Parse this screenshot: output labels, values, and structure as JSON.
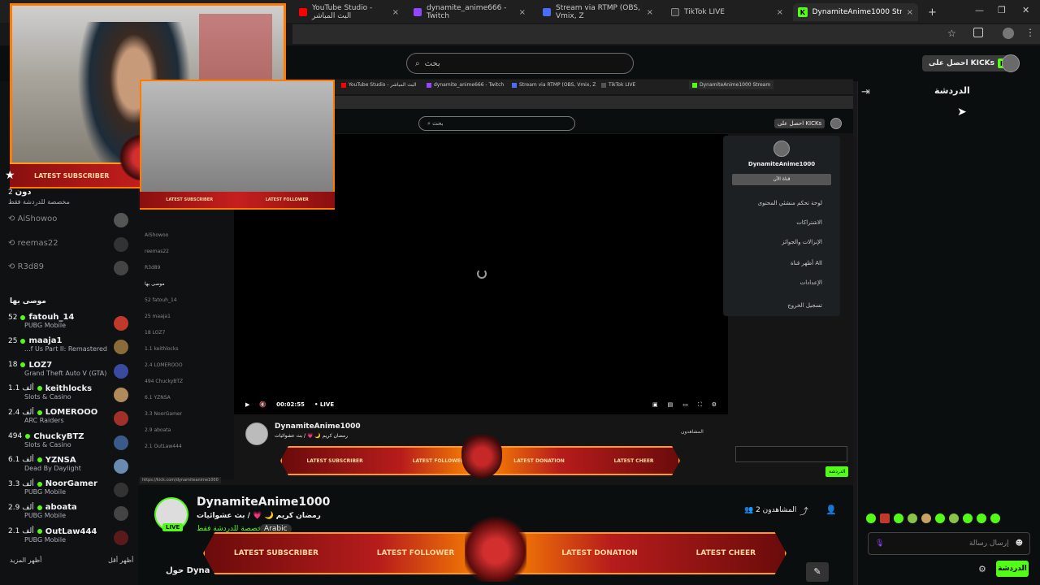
{
  "browser": {
    "tabs": [
      {
        "label": "YouTube Studio - البث المباشر",
        "color": "#ff0000"
      },
      {
        "label": "dynamite_anime666 - Twitch",
        "color": "#9146ff"
      },
      {
        "label": "Stream via RTMP (OBS, Vmix, Z",
        "color": "#4a6cf7"
      },
      {
        "label": "TikTok LIVE",
        "color": "#111111"
      },
      {
        "label": "DynamiteAnime1000 Stream",
        "color": "#53fc18"
      }
    ],
    "new_tab": "+",
    "close": "×"
  },
  "header": {
    "search_placeholder": "بحث",
    "get_kicks": "احصل على KICKs",
    "kick_badge": "K"
  },
  "chat_panel": {
    "title": "الدردشة",
    "input_placeholder": "إرسال رسالة",
    "chat_button": "الدردشة"
  },
  "sidebar": {
    "top_items": [
      {
        "count": "2",
        "name": "دون",
        "cat": "مخصصة للدردشة فقط"
      },
      {
        "name": "AiShowoo"
      },
      {
        "name": "reemas22"
      },
      {
        "name": "R3d89"
      }
    ],
    "recommended_title": "موصى بها",
    "channels": [
      {
        "count": "52",
        "name": "fatouh_14",
        "cat": "PUBG Mobile",
        "color": "#c0392b"
      },
      {
        "count": "25",
        "name": "maaja1",
        "cat": "...f Us Part II: Remastered",
        "color": "#8a6b3a"
      },
      {
        "count": "18",
        "name": "LOZ7",
        "cat": "Grand Theft Auto V (GTA)",
        "color": "#3a4aa0"
      },
      {
        "count": "1.1 ألف",
        "name": "keithlocks",
        "cat": "Slots & Casino",
        "color": "#b08a5a"
      },
      {
        "count": "2.4 ألف",
        "name": "LOMEROOO",
        "cat": "ARC Raiders",
        "color": "#a0302a"
      },
      {
        "count": "494",
        "name": "ChuckyBTZ",
        "cat": "Slots & Casino",
        "color": "#3a5a8a"
      },
      {
        "count": "6.1 ألف",
        "name": "YZNSA",
        "cat": "Dead By Daylight",
        "color": "#6a8ab0"
      },
      {
        "count": "3.3 ألف",
        "name": "NoorGamer",
        "cat": "PUBG Mobile",
        "color": "#333333"
      },
      {
        "count": "2.9 ألف",
        "name": "aboata",
        "cat": "PUBG Mobile",
        "color": "#444444"
      },
      {
        "count": "2.1 ألف",
        "name": "OutLaw444",
        "cat": "PUBG Mobile",
        "color": "#5a1a1a"
      }
    ],
    "show_more": "أظهر المزيد",
    "show_less": "أظهر أقل"
  },
  "stream": {
    "name": "DynamiteAnime1000",
    "title": "رمضان كريم 🌙 💗 / بث عشوائيات",
    "category": "مخصصة للدردشة فقط",
    "tag": "Arabic",
    "live": "LIVE",
    "viewers_label": "المشاهدون 2",
    "about": "حول Dyna"
  },
  "inner": {
    "search": "بحث",
    "get_kicks": "احصل على KICKs",
    "username": "DynamiteAnime1000",
    "menu_button": "قناة الآن",
    "menu": [
      "لوحة تحكم منشئي المحتوى",
      "الاشتراكات",
      "الإنزالات والجوائز",
      "أظهر قناة All",
      "الإعدادات",
      "تسجيل الخروج"
    ],
    "time": "00:02:55",
    "live": "• LIVE",
    "url": "https://kick.com/dynamiteanime1000",
    "stream_name": "DynamiteAnime1000",
    "stream_title": "رمضان كريم 🌙 💗 / بث عشوائيات",
    "viewers": "المشاهدون",
    "chat_btn": "الدردشة"
  },
  "overlay": {
    "latest_subscriber": "LATEST SUBSCRIBER",
    "latest_follower": "LATEST FOLLOWER",
    "latest_donation": "LATEST DONATION",
    "latest_cheer": "LATEST CHEER"
  },
  "colors": {
    "accent": "#53fc18",
    "overlay_orange": "#ff9a1a",
    "overlay_red": "#b71c1c"
  }
}
